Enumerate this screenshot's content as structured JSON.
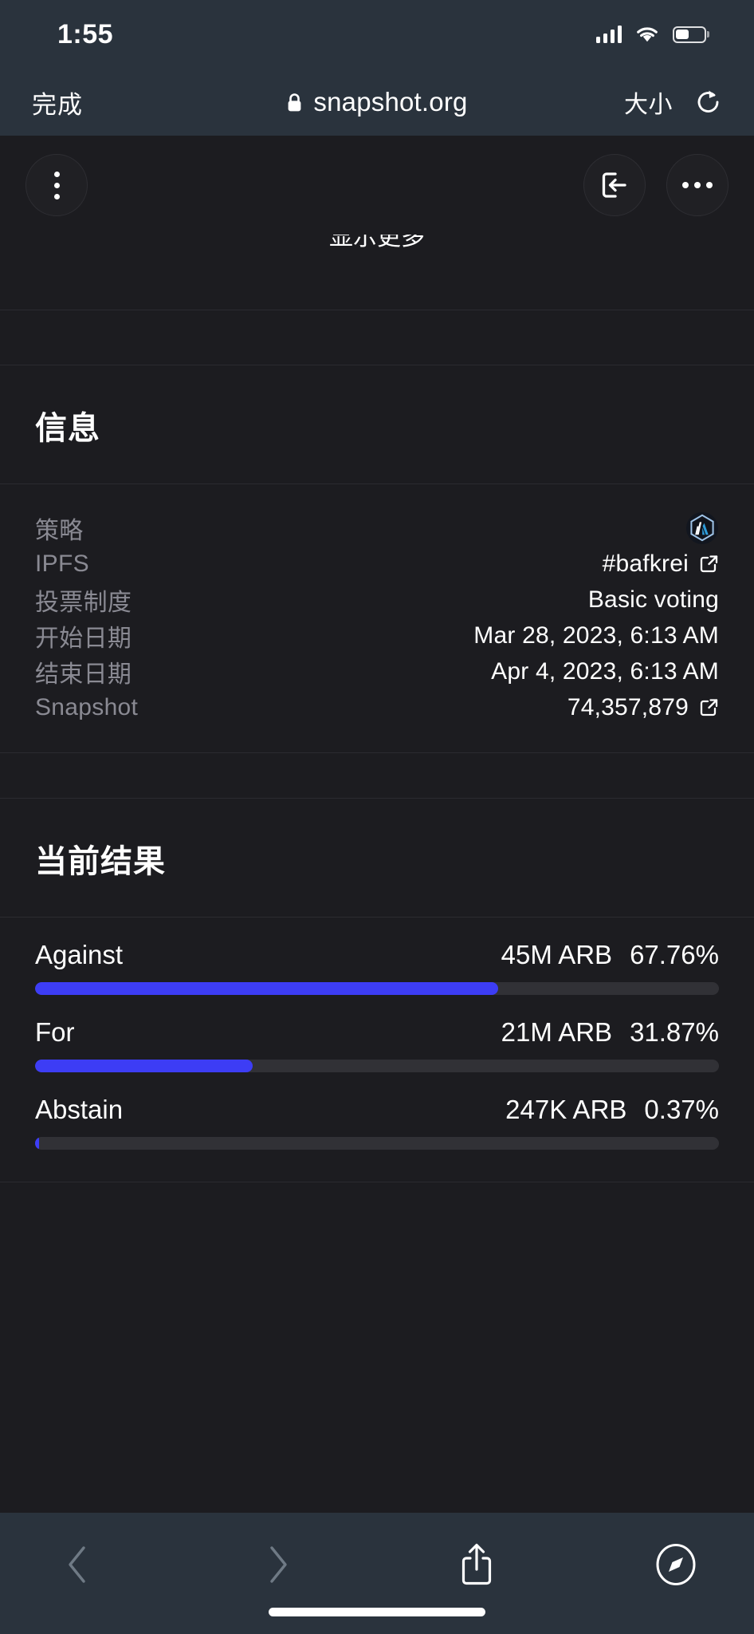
{
  "status_bar": {
    "time": "1:55",
    "cellular_icon": "cellular-signal-icon",
    "wifi_icon": "wifi-icon",
    "battery_icon": "battery-icon"
  },
  "browser": {
    "done_label": "完成",
    "lock_icon": "lock-icon",
    "url": "snapshot.org",
    "size_label": "大小",
    "reload_icon": "reload-icon"
  },
  "page_toolbar": {
    "menu_icon": "kebab-menu-icon",
    "login_icon": "login-icon",
    "more_icon": "ellipsis-icon"
  },
  "clipped": {
    "show_more_label": "显示更多"
  },
  "info_section": {
    "title": "信息",
    "rows": [
      {
        "label": "策略",
        "value": "",
        "icon": "arbitrum-logo-icon",
        "link": false
      },
      {
        "label": "IPFS",
        "value": "#bafkrei",
        "icon": "external-link-icon",
        "link": true
      },
      {
        "label": "投票制度",
        "value": "Basic voting",
        "icon": "",
        "link": false
      },
      {
        "label": "开始日期",
        "value": "Mar 28, 2023, 6:13 AM",
        "icon": "",
        "link": false
      },
      {
        "label": "结束日期",
        "value": "Apr 4, 2023, 6:13 AM",
        "icon": "",
        "link": false
      },
      {
        "label": "Snapshot",
        "value": "74,357,879",
        "icon": "external-link-icon",
        "link": true
      }
    ]
  },
  "results_section": {
    "title": "当前结果",
    "bar_color": "#3d3df5",
    "track_color": "#313136",
    "rows": [
      {
        "choice": "Against",
        "amount": "45M ARB",
        "percent": "67.76%",
        "fill": 67.76
      },
      {
        "choice": "For",
        "amount": "21M ARB",
        "percent": "31.87%",
        "fill": 31.87
      },
      {
        "choice": "Abstain",
        "amount": "247K ARB",
        "percent": "0.37%",
        "fill": 0.37
      }
    ]
  },
  "bottom_toolbar": {
    "back_icon": "back-chevron-icon",
    "forward_icon": "forward-chevron-icon",
    "share_icon": "share-icon",
    "tabs_icon": "safari-compass-icon"
  }
}
